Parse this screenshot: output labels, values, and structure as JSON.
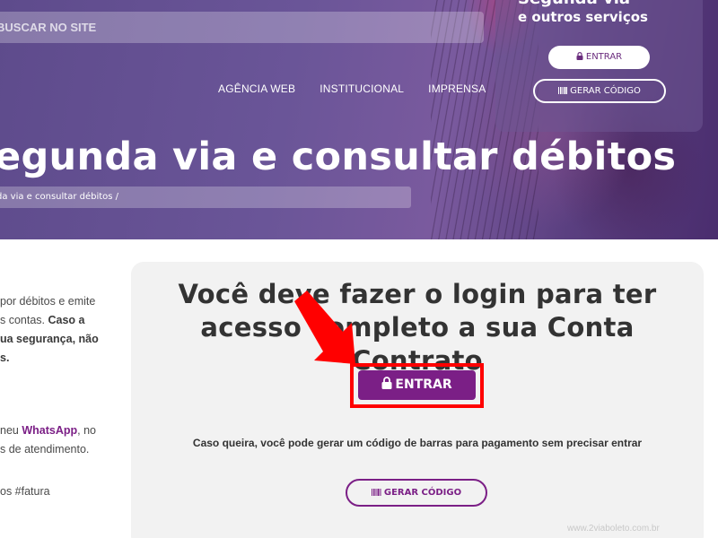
{
  "search": {
    "placeholder": "BUSCAR NO SITE"
  },
  "nav": {
    "items": [
      "AGÊNCIA WEB",
      "INSTITUCIONAL",
      "IMPRENSA"
    ]
  },
  "hero": {
    "title": "egunda via e consultar débitos",
    "breadcrumb": "da via e consultar débitos /"
  },
  "login_card": {
    "title": "Segunda via",
    "subtitle": "e outros serviços",
    "enter_label": "ENTRAR",
    "code_label": "GERAR CÓDIGO"
  },
  "left_text": {
    "line1": "por débitos e emite",
    "line2_a": "s contas. ",
    "line2_b": "Caso a",
    "line3": "ua segurança, não",
    "line4": "s.",
    "line5_a": "neu ",
    "line5_b": "WhatsApp",
    "line5_c": ", no",
    "line6": "s de atendimento.",
    "line7": "os #fatura"
  },
  "panel": {
    "heading_line1": "Você deve fazer o login para ter",
    "heading_line2": "acesso completo a sua Conta Contrato",
    "enter_label": "ENTRAR",
    "note": "Caso queira, você pode gerar um código de barras para pagamento sem precisar entrar",
    "code_label": "GERAR CÓDIGO"
  },
  "watermark": "www.2viaboleto.com.br",
  "colors": {
    "brand_purple": "#7b1f86",
    "highlight_red": "#ff0000"
  },
  "icons": {
    "lock": "lock-icon",
    "barcode": "barcode-icon",
    "arrow": "arrow-down-right-icon"
  }
}
